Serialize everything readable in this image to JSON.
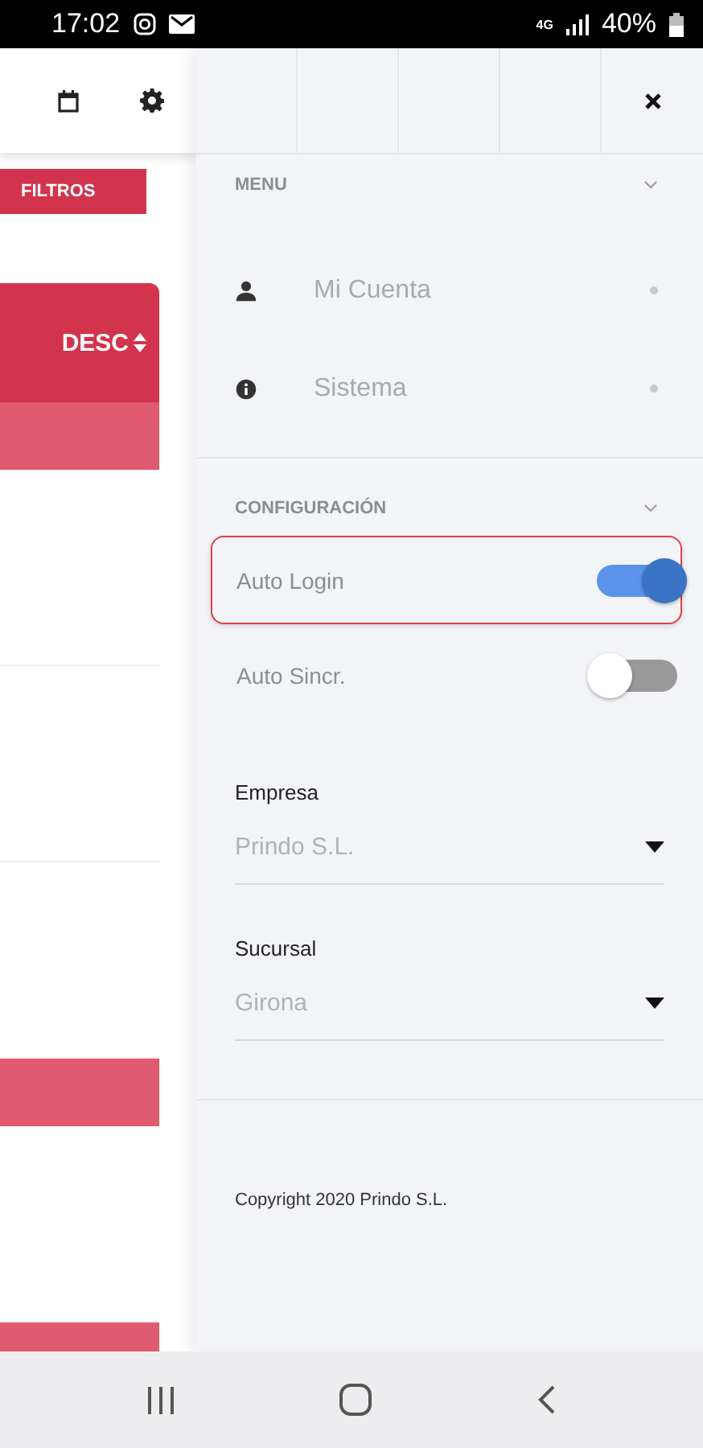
{
  "status_bar": {
    "time": "17:02",
    "network": "4G",
    "battery": "40%"
  },
  "background": {
    "filter_button": "FILTROS",
    "sort_label": "DESC"
  },
  "drawer": {
    "menu": {
      "title": "MENU",
      "expanded": true,
      "items": [
        {
          "label": "Mi Cuenta",
          "kind": "account"
        },
        {
          "label": "Sistema",
          "kind": "info"
        }
      ]
    },
    "settings": {
      "title": "CONFIGURACIÓN",
      "expanded": true,
      "toggles": [
        {
          "label": "Auto Login",
          "on": true,
          "focused": true
        },
        {
          "label": "Auto Sincr.",
          "on": false,
          "focused": false
        }
      ],
      "selects": [
        {
          "label": "Empresa",
          "value": "Prindo S.L."
        },
        {
          "label": "Sucursal",
          "value": "Girona"
        }
      ]
    },
    "footer": "Copyright 2020 Prindo S.L."
  }
}
